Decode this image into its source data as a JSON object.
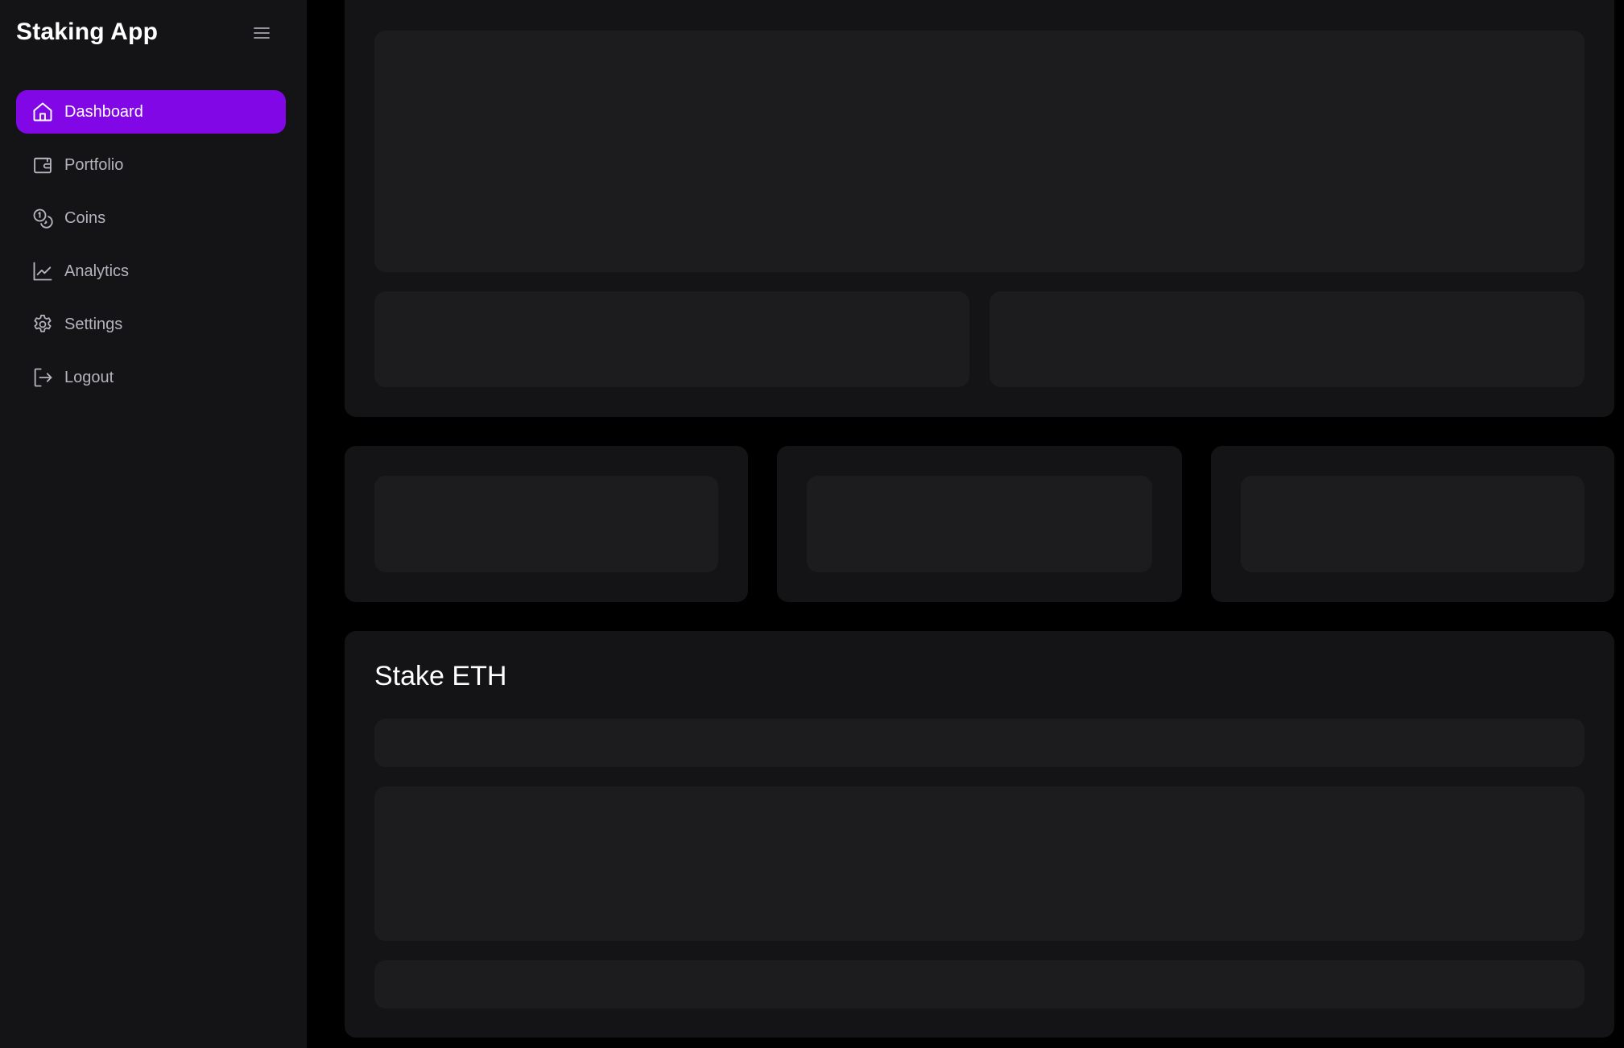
{
  "app": {
    "title": "Staking App"
  },
  "sidebar": {
    "items": [
      {
        "label": "Dashboard",
        "icon": "home-icon",
        "active": true
      },
      {
        "label": "Portfolio",
        "icon": "wallet-icon",
        "active": false
      },
      {
        "label": "Coins",
        "icon": "coins-icon",
        "active": false
      },
      {
        "label": "Analytics",
        "icon": "chart-line-icon",
        "active": false
      },
      {
        "label": "Settings",
        "icon": "gear-icon",
        "active": false
      },
      {
        "label": "Logout",
        "icon": "logout-icon",
        "active": false
      }
    ]
  },
  "stake": {
    "title": "Stake ETH"
  },
  "colors": {
    "accent": "#8207e6",
    "background": "#000000",
    "card": "#141417",
    "placeholder": "#1c1c1f",
    "nav_text": "#b4b4bc"
  }
}
